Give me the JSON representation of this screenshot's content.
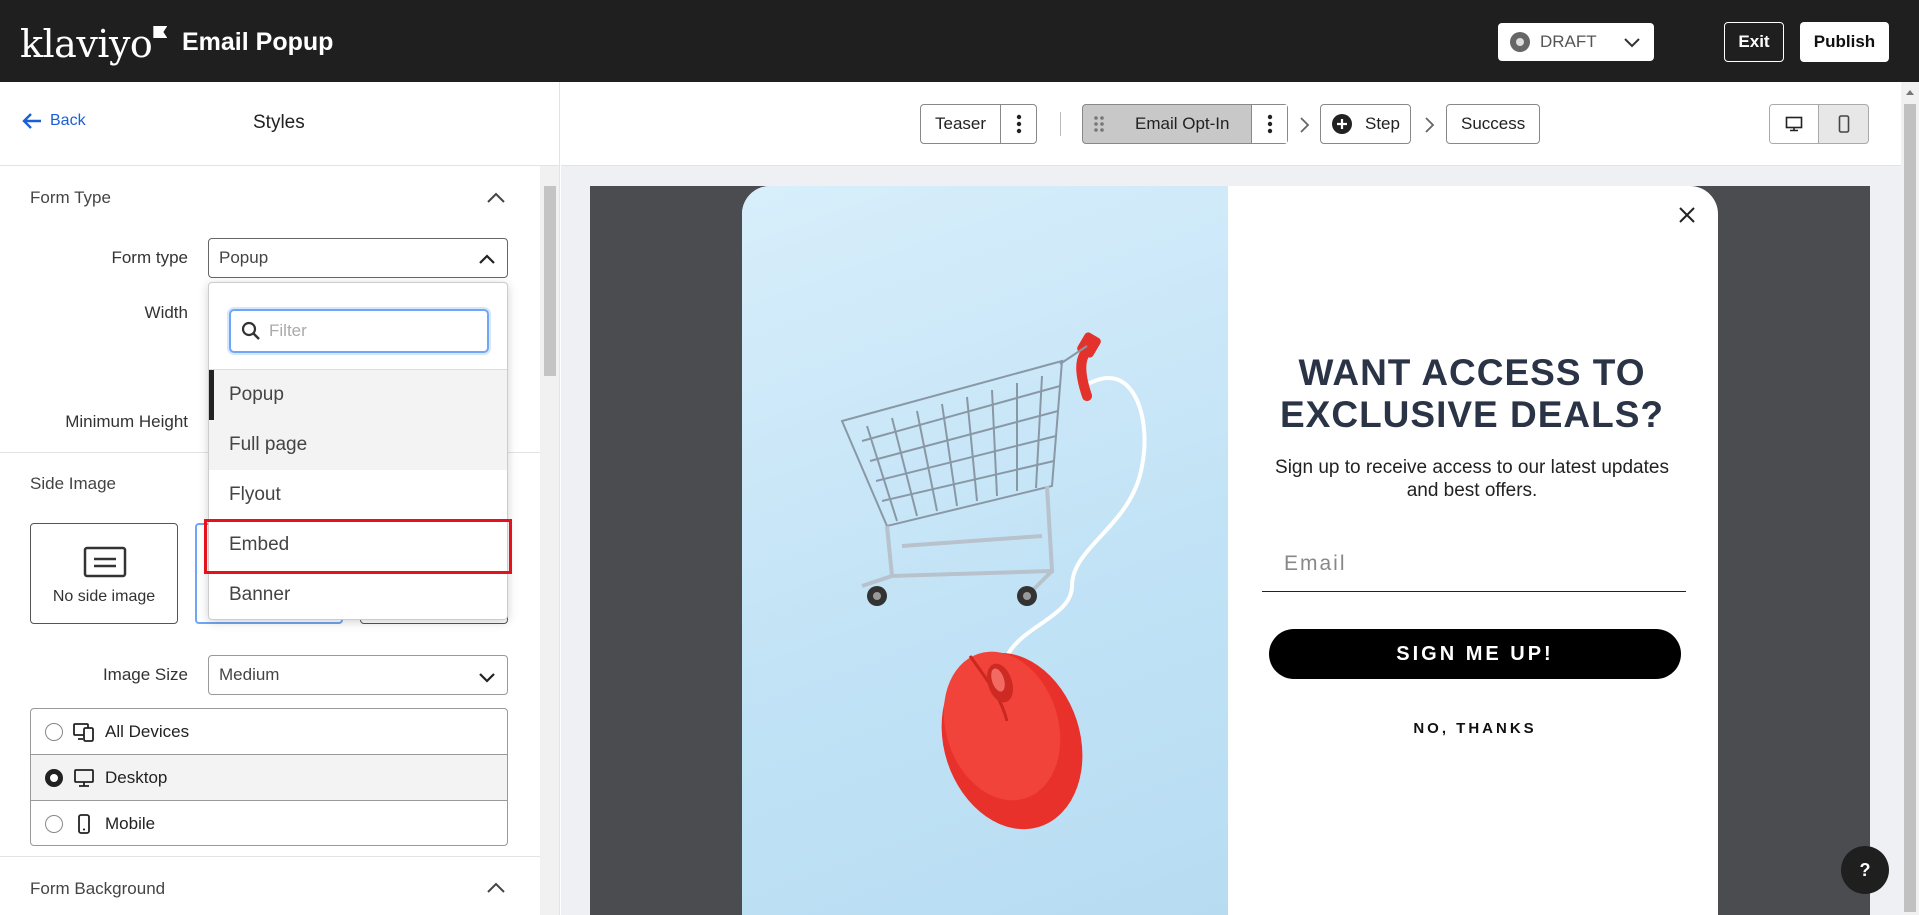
{
  "topbar": {
    "logo_text": "klaviyo",
    "title": "Email Popup",
    "status": "DRAFT",
    "exit_label": "Exit",
    "publish_label": "Publish"
  },
  "left_panel": {
    "back_label": "Back",
    "title": "Styles",
    "form_type_section": {
      "title": "Form Type",
      "form_type_label": "Form type",
      "form_type_value": "Popup",
      "width_label": "Width",
      "min_height_label": "Minimum Height"
    },
    "side_image_section": {
      "title": "Side Image",
      "no_side_image_label": "No side image",
      "image_size_label": "Image Size",
      "image_size_value": "Medium"
    },
    "devices": [
      {
        "label": "All Devices",
        "selected": false
      },
      {
        "label": "Desktop",
        "selected": true
      },
      {
        "label": "Mobile",
        "selected": false
      }
    ],
    "form_background_section": {
      "title": "Form Background"
    }
  },
  "dropdown": {
    "filter_placeholder": "Filter",
    "options": [
      "Popup",
      "Full page",
      "Flyout",
      "Embed",
      "Banner"
    ],
    "selected": "Popup",
    "hovered": "Full page",
    "annotated": "Embed"
  },
  "step_bar": {
    "teaser_label": "Teaser",
    "email_optin_label": "Email Opt-In",
    "step_label": "Step",
    "success_label": "Success",
    "view_mode": "desktop"
  },
  "popup": {
    "heading": "WANT ACCESS TO EXCLUSIVE DEALS?",
    "subtext": "Sign up to receive access to our latest updates and best offers.",
    "email_placeholder": "Email",
    "signup_label": "SIGN ME UP!",
    "no_thanks_label": "NO, THANKS"
  },
  "help_label": "?",
  "colors": {
    "topbar_bg": "#1f1f1f",
    "link_blue": "#1c5fd6",
    "highlight_red": "#e3121d",
    "preview_bg": "#4a4c50",
    "heading_color": "#2b3446",
    "mouse_red": "#e8312b"
  }
}
